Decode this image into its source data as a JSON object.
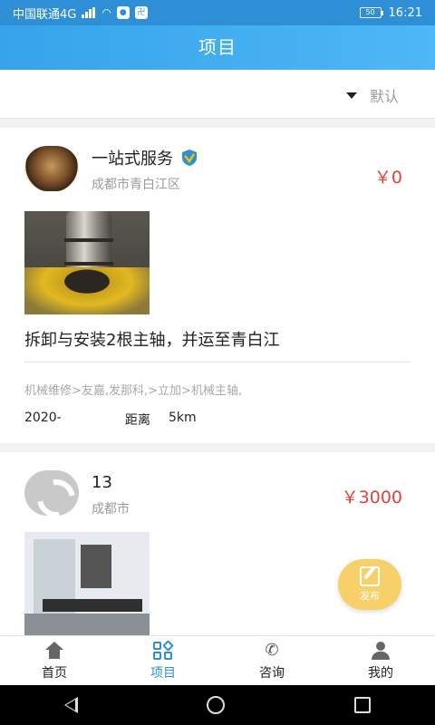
{
  "status_bar": {
    "carrier": "中国联通4G",
    "battery": "50",
    "time": "16:21",
    "icons": [
      "signal-icon",
      "wifi-icon",
      "app-badge-icon",
      "app-badge-icon",
      "battery-icon"
    ]
  },
  "header": {
    "title": "项目"
  },
  "filter": {
    "sort_label": "默认",
    "sort_icon": "triangle-down-icon"
  },
  "projects": [
    {
      "user_name": "一站式服务",
      "verified": true,
      "city": "成都市青白江区",
      "price": "￥0",
      "title": "拆卸与安装2根主轴，并运至青白江",
      "tags": "机械维修>友嘉,发那科,>立加>机械主轴,",
      "date": "2020-",
      "distance_label": "距离",
      "distance": "5km"
    },
    {
      "user_name": "13",
      "verified": false,
      "city": "成都市",
      "price": "￥3000"
    }
  ],
  "fab": {
    "label": "发布",
    "icon": "edit-note-icon"
  },
  "tabs": [
    {
      "label": "首页",
      "icon": "home-icon",
      "active": false
    },
    {
      "label": "项目",
      "icon": "grid-icon",
      "active": true
    },
    {
      "label": "咨询",
      "icon": "phone-icon",
      "active": false
    },
    {
      "label": "我的",
      "icon": "user-icon",
      "active": false
    }
  ],
  "colors": {
    "accent": "#2e8fd6",
    "price": "#e0433b",
    "fab": "#f7d06a"
  }
}
